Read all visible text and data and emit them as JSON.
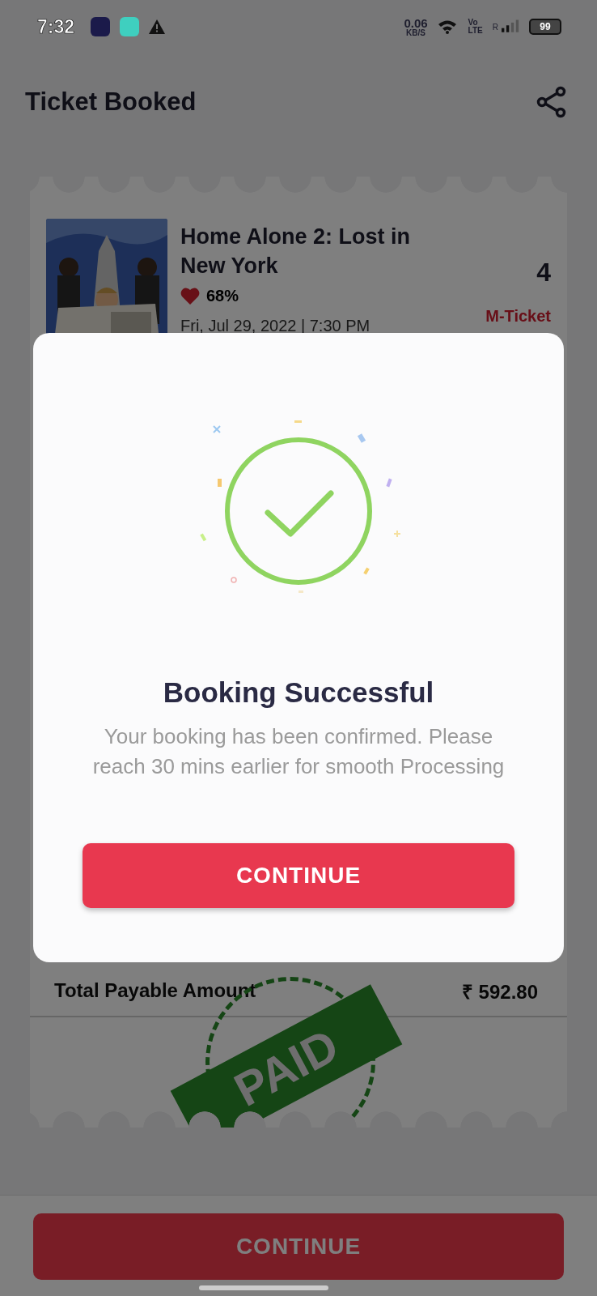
{
  "status_bar": {
    "time": "7:32",
    "speed_value": "0.06",
    "speed_unit": "KB/S",
    "volte_top": "Vo",
    "volte_bottom": "LTE",
    "roaming": "R",
    "battery": "99"
  },
  "header": {
    "title": "Ticket Booked"
  },
  "ticket": {
    "movie_title": "Home Alone 2: Lost in New York",
    "rating": "68%",
    "showtime": "Fri, Jul 29, 2022 | 7:30 PM",
    "seat_count": "4",
    "ticket_type": "M-Ticket",
    "total_label": "Total Payable Amount",
    "total_value": "₹ 592.80",
    "stamp": "PAID"
  },
  "dialog": {
    "title": "Booking Successful",
    "message": "Your booking has been confirmed. Please reach 30 mins earlier for smooth Processing",
    "button": "CONTINUE"
  },
  "footer": {
    "button": "CONTINUE"
  }
}
